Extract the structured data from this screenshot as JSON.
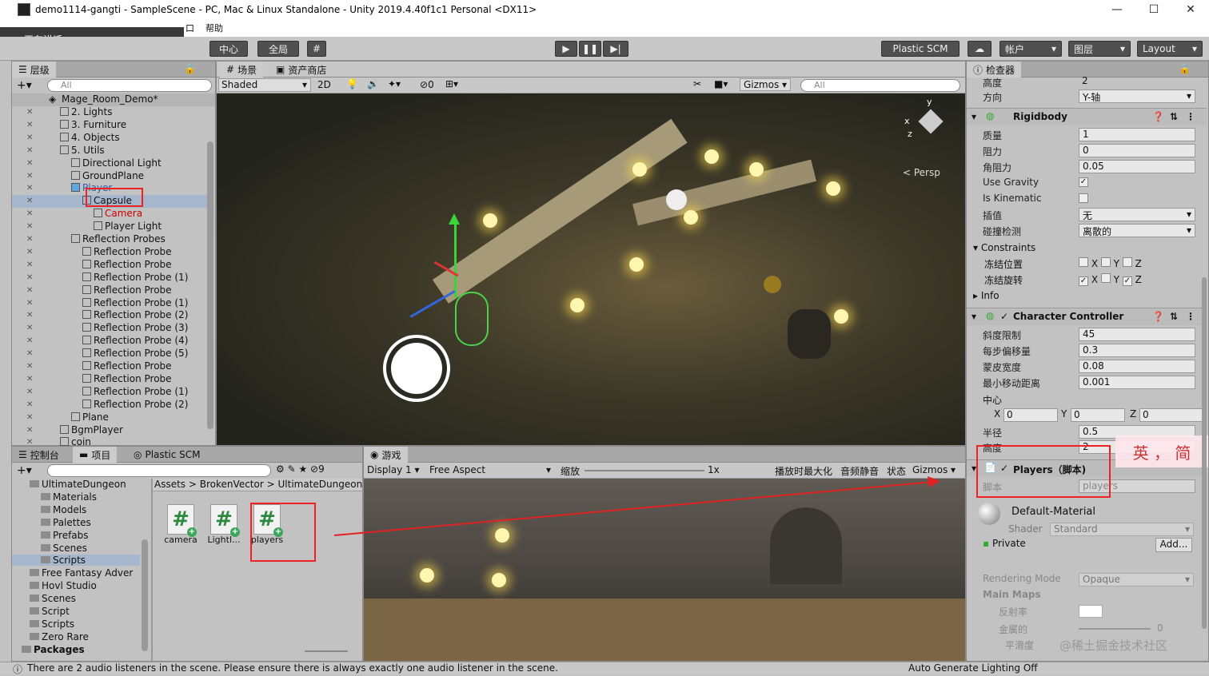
{
  "window": {
    "title": "demo1114-gangti - SampleScene - PC, Mac & Linux Standalone - Unity 2019.4.40f1c1 Personal <DX11>"
  },
  "menu": {
    "help": "帮助",
    "box": "口"
  },
  "overlay": {
    "speaking": "正在讲话:"
  },
  "toolbar": {
    "center": "中心",
    "global": "全局",
    "plastic": "Plastic SCM",
    "account": "帐户",
    "layers": "图层",
    "layout": "Layout"
  },
  "hierarchy": {
    "tab": "层级",
    "search": "All",
    "scene_name": "Mage_Room_Demo*",
    "items": [
      {
        "label": "2. Lights",
        "indent": 1
      },
      {
        "label": "3. Furniture",
        "indent": 1
      },
      {
        "label": "4. Objects",
        "indent": 1
      },
      {
        "label": "5. Utils",
        "indent": 1
      },
      {
        "label": "Directional Light",
        "indent": 2
      },
      {
        "label": "GroundPlane",
        "indent": 2
      },
      {
        "label": "Player",
        "indent": 2
      },
      {
        "label": "Capsule",
        "indent": 3
      },
      {
        "label": "Camera",
        "indent": 4
      },
      {
        "label": "Player Light",
        "indent": 4
      },
      {
        "label": "Reflection Probes",
        "indent": 2
      },
      {
        "label": "Reflection Probe",
        "indent": 3
      },
      {
        "label": "Reflection Probe",
        "indent": 3
      },
      {
        "label": "Reflection Probe (1)",
        "indent": 3
      },
      {
        "label": "Reflection Probe",
        "indent": 3
      },
      {
        "label": "Reflection Probe (1)",
        "indent": 3
      },
      {
        "label": "Reflection Probe (2)",
        "indent": 3
      },
      {
        "label": "Reflection Probe (3)",
        "indent": 3
      },
      {
        "label": "Reflection Probe (4)",
        "indent": 3
      },
      {
        "label": "Reflection Probe (5)",
        "indent": 3
      },
      {
        "label": "Reflection Probe",
        "indent": 3
      },
      {
        "label": "Reflection Probe",
        "indent": 3
      },
      {
        "label": "Reflection Probe (1)",
        "indent": 3
      },
      {
        "label": "Reflection Probe (2)",
        "indent": 3
      },
      {
        "label": "Plane",
        "indent": 2
      },
      {
        "label": "BgmPlayer",
        "indent": 1
      },
      {
        "label": "coin",
        "indent": 1
      }
    ]
  },
  "scene": {
    "tab_scene": "场景",
    "tab_store": "资产商店",
    "shading": "Shaded",
    "mode2d": "2D",
    "hidden_count": "0",
    "gizmos": "Gizmos",
    "search": "All",
    "persp": "< Persp",
    "axis_y": "y",
    "axis_x": "x",
    "axis_z": "z"
  },
  "bottom": {
    "tab_console": "控制台",
    "tab_project": "项目",
    "tab_plastic": "Plastic SCM",
    "hidden": "9",
    "tree": [
      {
        "label": "UltimateDungeon",
        "indent": 1
      },
      {
        "label": "Materials",
        "indent": 2
      },
      {
        "label": "Models",
        "indent": 2
      },
      {
        "label": "Palettes",
        "indent": 2
      },
      {
        "label": "Prefabs",
        "indent": 2
      },
      {
        "label": "Scenes",
        "indent": 2
      },
      {
        "label": "Scripts",
        "indent": 2
      },
      {
        "label": "Free Fantasy Adver",
        "indent": 1
      },
      {
        "label": "Hovl Studio",
        "indent": 1
      },
      {
        "label": "Scenes",
        "indent": 1
      },
      {
        "label": "Script",
        "indent": 1
      },
      {
        "label": "Scripts",
        "indent": 1
      },
      {
        "label": "Zero Rare",
        "indent": 1
      },
      {
        "label": "Packages",
        "indent": 0
      }
    ],
    "breadcrumb": [
      "Assets",
      ">",
      "BrokenVector",
      ">",
      "UltimateDungeonP"
    ],
    "files": [
      "camera",
      "Lightl...",
      "players"
    ]
  },
  "game": {
    "tab": "游戏",
    "display": "Display 1",
    "aspect": "Free Aspect",
    "zoom_label": "缩放",
    "zoom_value": "1x",
    "maximize": "播放时最大化",
    "mute": "音频静音",
    "stats": "状态",
    "gizmos": "Gizmos"
  },
  "inspector": {
    "tab": "检查器",
    "height_top": {
      "k": "高度",
      "v": "2"
    },
    "direction": {
      "k": "方向",
      "v": "Y-轴"
    },
    "rigidbody": {
      "title": "Rigidbody",
      "rows": [
        {
          "k": "质量",
          "v": "1"
        },
        {
          "k": "阻力",
          "v": "0"
        },
        {
          "k": "角阻力",
          "v": "0.05"
        },
        {
          "k": "Use Gravity",
          "v": "✓"
        },
        {
          "k": "Is Kinematic",
          "v": ""
        },
        {
          "k": "插值",
          "v": "无"
        },
        {
          "k": "碰撞检测",
          "v": "离散的"
        }
      ],
      "constraints": "Constraints",
      "freeze_pos": "冻结位置",
      "freeze_rot": "冻结旋转",
      "info": "Info",
      "xyz": [
        "X",
        "Y",
        "Z"
      ]
    },
    "cc": {
      "title": "Character Controller",
      "rows": [
        {
          "k": "斜度限制",
          "v": "45"
        },
        {
          "k": "每步偏移量",
          "v": "0.3"
        },
        {
          "k": "蒙皮宽度",
          "v": "0.08"
        },
        {
          "k": "最小移动距离",
          "v": "0.001"
        }
      ],
      "center": "中心",
      "cx": "0",
      "cy": "0",
      "cz": "0",
      "radius_k": "半径",
      "radius_v": "0.5",
      "height_k": "高度",
      "height_v": "2"
    },
    "players": {
      "title": "Players（脚本)",
      "script_k": "脚本",
      "script_v": "players"
    },
    "material": {
      "name": "Default-Material",
      "shader_k": "Shader",
      "shader_v": "Standard",
      "private": "Private",
      "add": "Add...",
      "render_k": "Rendering Mode",
      "render_v": "Opaque",
      "main_maps": "Main Maps",
      "albedo": "反射率",
      "metallic": "金属的",
      "metallic_v": "0",
      "smooth": "平滑度"
    },
    "ime": "英 ， 简"
  },
  "watermark": "@稀土掘金技术社区",
  "status": {
    "message": "There are 2 audio listeners in the scene. Please ensure there is always exactly one audio listener in the scene.",
    "right": "Auto Generate Lighting Off"
  },
  "colors": {
    "red": "#e22222",
    "accent": "#3a7bd5"
  }
}
